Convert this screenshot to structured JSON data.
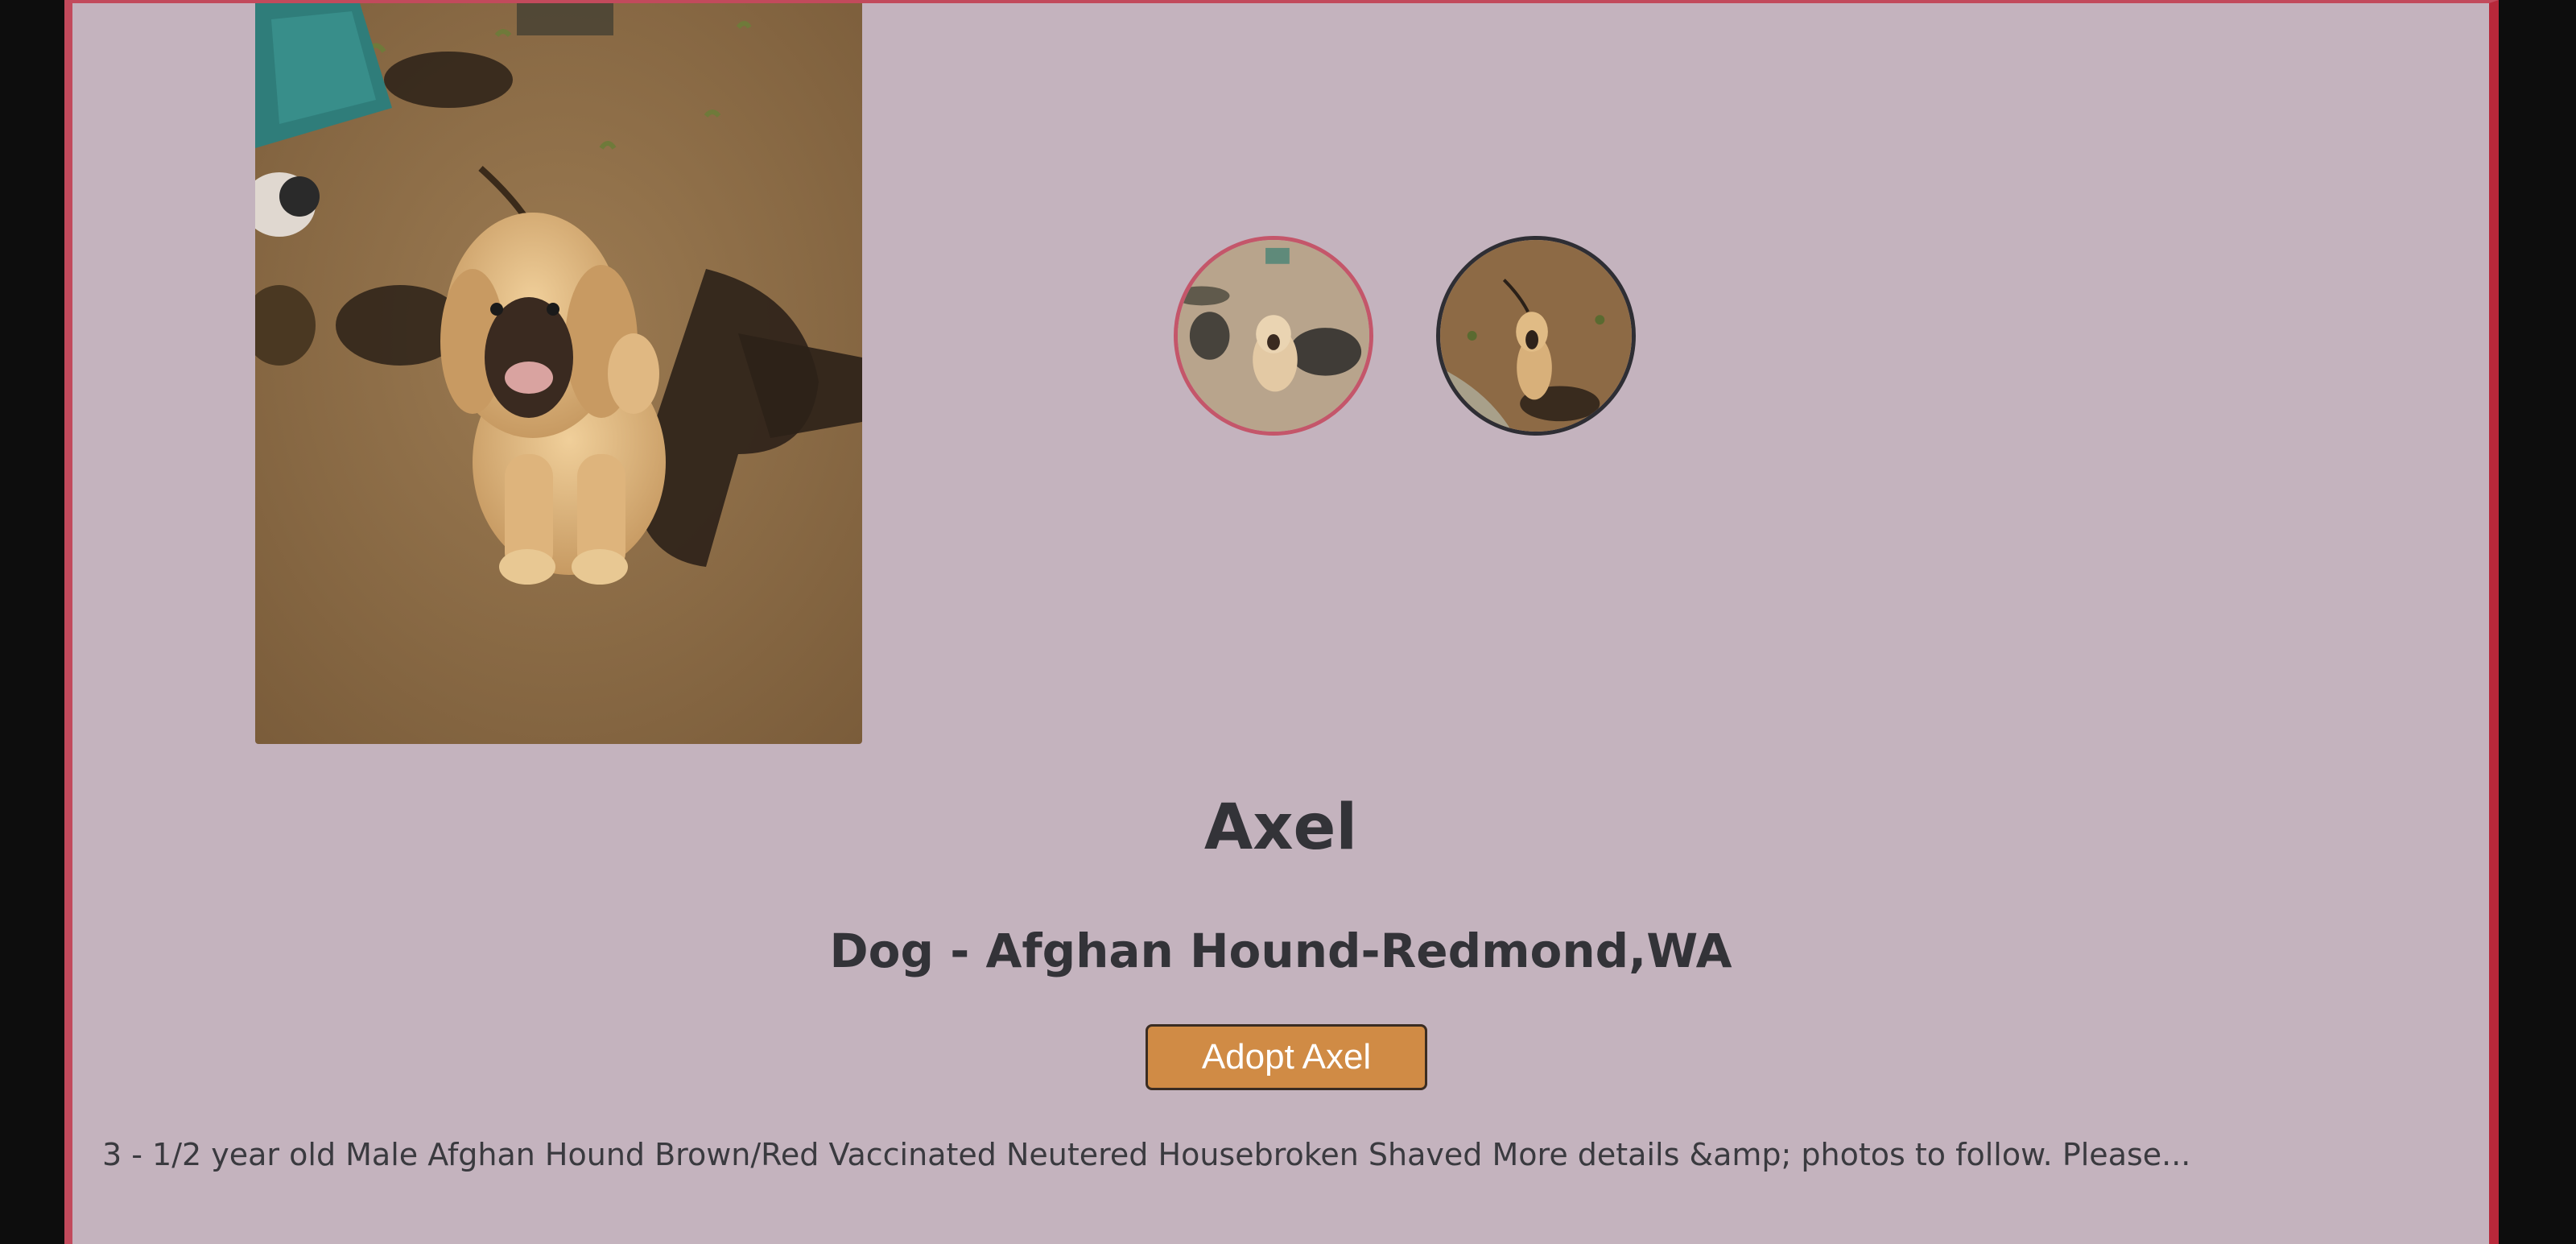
{
  "pet": {
    "name": "Axel",
    "subtitle": "Dog - Afghan Hound-Redmond,WA",
    "adopt_label": "Adopt Axel",
    "description": "3 - 1/2 year old Male Afghan Hound Brown/Red Vaccinated Neutered Housebroken Shaved More details &amp; photos to follow. Please..."
  },
  "photos": {
    "main": "dog-photo",
    "thumbnails": [
      "dog-photo-thumbnail",
      "dog-photo-thumbnail"
    ],
    "selected_index": 0
  },
  "colors": {
    "panel_bg": "#c4b3be",
    "accent_border": "#c24a5c",
    "button_bg": "#d08b45",
    "text": "#333338"
  }
}
